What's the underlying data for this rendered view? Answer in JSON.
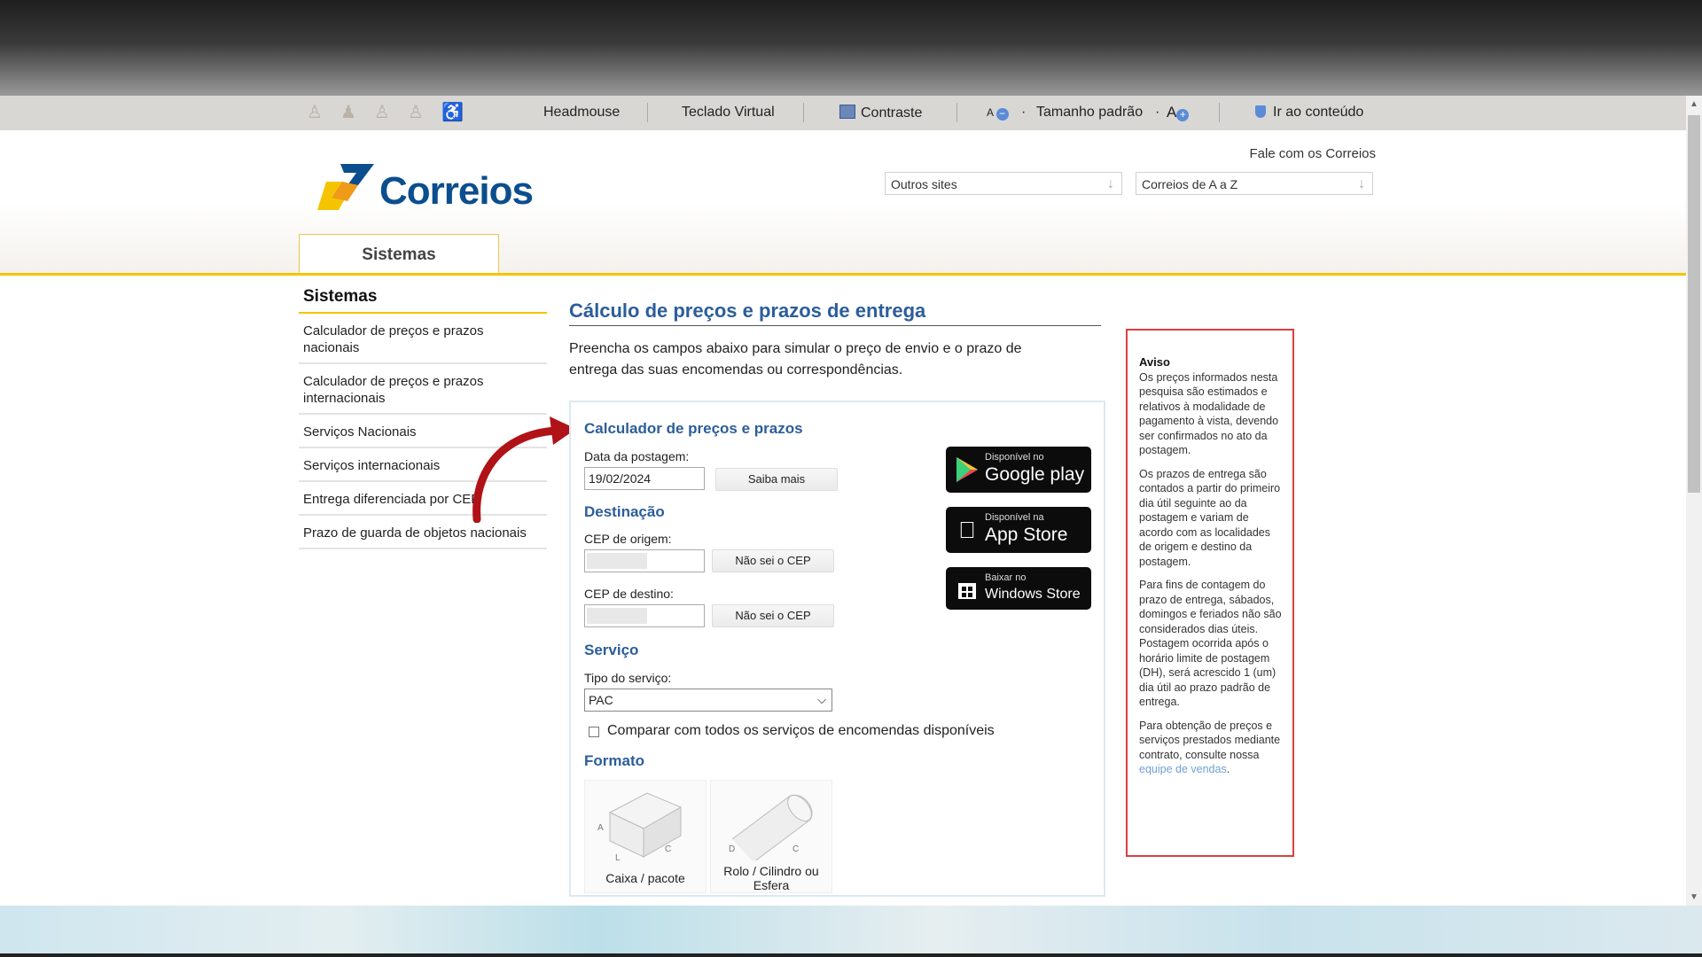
{
  "accessibility_bar": {
    "headmouse": "Headmouse",
    "teclado_virtual": "Teclado Virtual",
    "contraste": "Contraste",
    "font_small": "A",
    "tamanho_padrao": "Tamanho padrão",
    "font_large": "A",
    "ir_ao_conteudo": "Ir ao conteúdo"
  },
  "header": {
    "logo_text": "Correios",
    "fale": "Fale com os Correios",
    "outros_sites": "Outros sites",
    "correios_az": "Correios de A a Z",
    "tab": "Sistemas"
  },
  "sidebar": {
    "title": "Sistemas",
    "items": [
      "Calculador de preços e prazos nacionais",
      "Calculador de preços e prazos internacionais",
      "Serviços Nacionais",
      "Serviços internacionais",
      "Entrega diferenciada por CEP",
      "Prazo de guarda de objetos nacionais"
    ]
  },
  "main": {
    "title": "Cálculo de preços e prazos de entrega",
    "intro": "Preencha os campos abaixo para simular o preço de envio e o prazo de entrega das suas encomendas ou correspondências."
  },
  "calculator": {
    "title": "Calculador de preços e prazos",
    "data_label": "Data da postagem:",
    "data_value": "19/02/2024",
    "saiba_mais": "Saiba mais",
    "destinacao": "Destinação",
    "cep_origem_label": "CEP de origem:",
    "cep_destino_label": "CEP de destino:",
    "nao_sei_cep": "Não sei o CEP",
    "servico": "Serviço",
    "tipo_label": "Tipo do serviço:",
    "tipo_value": "PAC",
    "comparar": "Comparar com todos os serviços de encomendas disponíveis",
    "formato": "Formato",
    "formato_caixa": "Caixa / pacote",
    "formato_rolo": "Rolo / Cilindro ou Esfera"
  },
  "stores": {
    "google_small": "Disponível no",
    "google_big": "Google play",
    "apple_small": "Disponível na",
    "apple_big": "App Store",
    "windows_small": "Baixar no",
    "windows_big": "Windows Store"
  },
  "aviso": {
    "title": "Aviso",
    "p1": "Os preços informados nesta pesquisa são estimados e relativos à modalidade de pagamento à vista, devendo ser confirmados no ato da postagem.",
    "p2": "Os prazos de entrega são contados a partir do primeiro dia útil seguinte ao da postagem e variam de acordo com as localidades de origem e destino da postagem.",
    "p3": "Para fins de contagem do prazo de entrega, sábados, domingos e feriados não são considerados dias úteis. Postagem ocorrida após o horário limite de postagem (DH), será acrescido 1 (um) dia útil ao prazo padrão de entrega.",
    "p4_text": "Para obtenção de preços e serviços prestados mediante contrato, consulte nossa",
    "p4_link": "equipe de vendas",
    "p4_end": "."
  },
  "colors": {
    "brand_blue": "#0b4e8e",
    "brand_yellow": "#f5c400",
    "title_blue": "#2c5d9a",
    "aviso_border": "#d94040"
  }
}
